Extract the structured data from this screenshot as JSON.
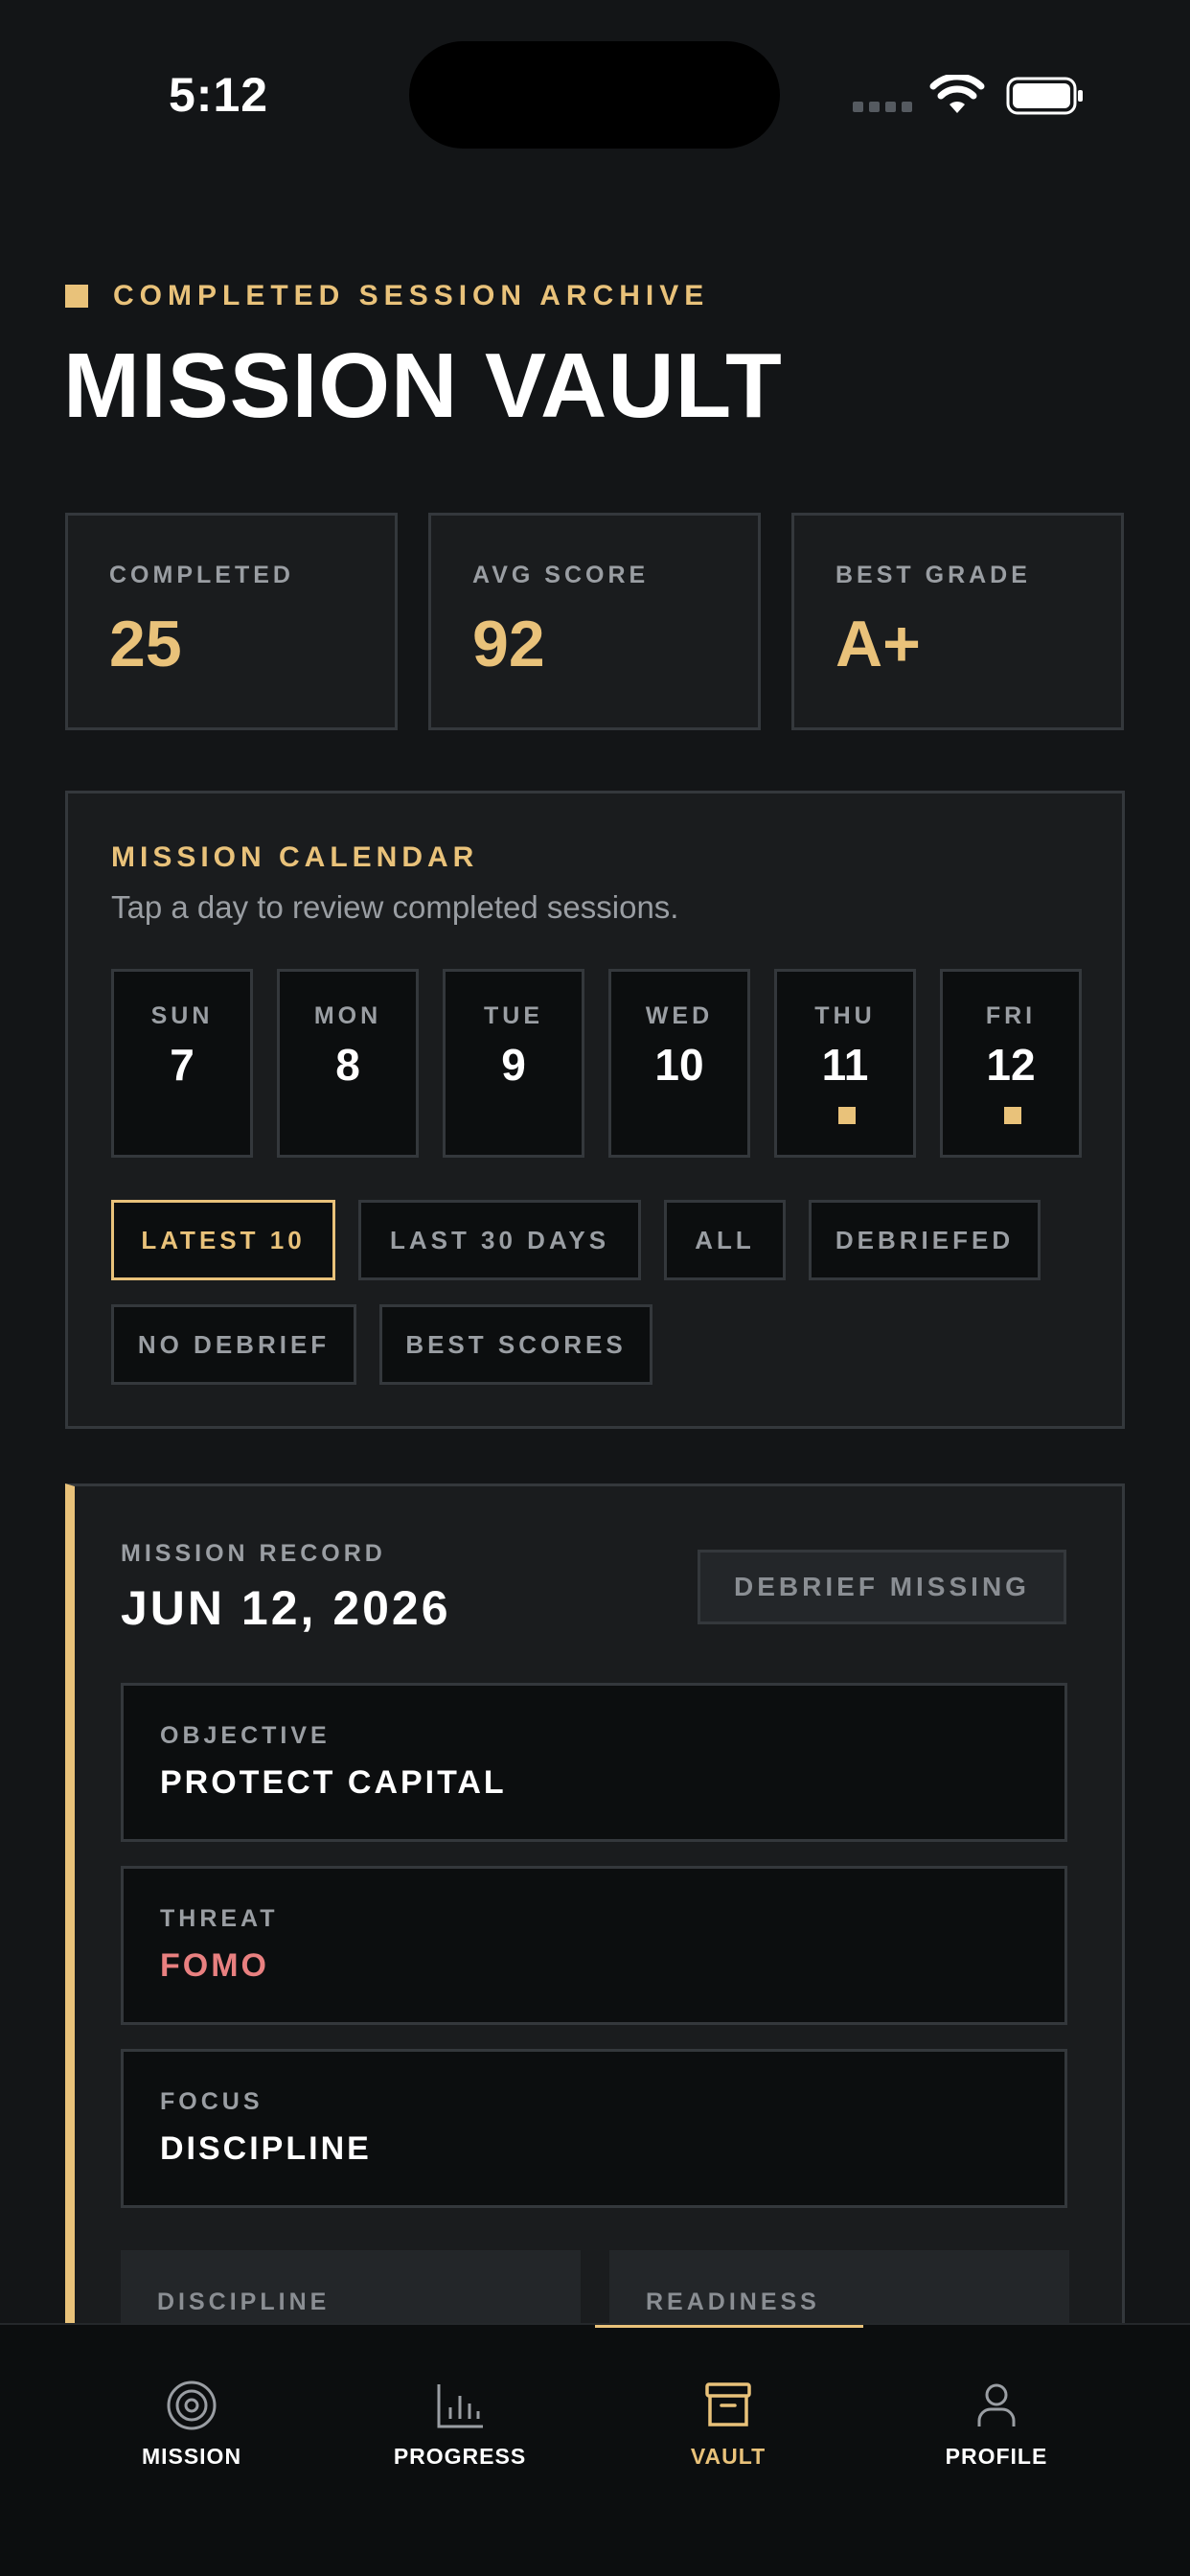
{
  "status_bar": {
    "time": "5:12"
  },
  "header": {
    "eyebrow": "COMPLETED SESSION ARCHIVE",
    "title": "MISSION VAULT"
  },
  "stats": [
    {
      "label": "COMPLETED",
      "value": "25"
    },
    {
      "label": "AVG SCORE",
      "value": "92"
    },
    {
      "label": "BEST GRADE",
      "value": "A+"
    }
  ],
  "calendar": {
    "title": "MISSION CALENDAR",
    "subtitle": "Tap a day to review completed sessions.",
    "days": [
      {
        "name": "SUN",
        "num": "7",
        "has_session": false
      },
      {
        "name": "MON",
        "num": "8",
        "has_session": false
      },
      {
        "name": "TUE",
        "num": "9",
        "has_session": false
      },
      {
        "name": "WED",
        "num": "10",
        "has_session": false
      },
      {
        "name": "THU",
        "num": "11",
        "has_session": true
      },
      {
        "name": "FRI",
        "num": "12",
        "has_session": true
      }
    ],
    "filters": [
      {
        "label": "LATEST 10",
        "active": true
      },
      {
        "label": "LAST 30 DAYS",
        "active": false
      },
      {
        "label": "ALL",
        "active": false
      },
      {
        "label": "DEBRIEFED",
        "active": false
      },
      {
        "label": "NO DEBRIEF",
        "active": false
      },
      {
        "label": "BEST SCORES",
        "active": false
      }
    ]
  },
  "record": {
    "label": "MISSION RECORD",
    "date": "JUN 12, 2026",
    "badge": "DEBRIEF MISSING",
    "fields": [
      {
        "label": "OBJECTIVE",
        "value": "PROTECT CAPITAL"
      },
      {
        "label": "THREAT",
        "value": "FOMO"
      },
      {
        "label": "FOCUS",
        "value": "DISCIPLINE"
      }
    ],
    "metrics": [
      {
        "label": "DISCIPLINE"
      },
      {
        "label": "READINESS"
      }
    ]
  },
  "tabs": [
    {
      "label": "MISSION",
      "icon": "target-icon",
      "active": false
    },
    {
      "label": "PROGRESS",
      "icon": "bar-chart-icon",
      "active": false
    },
    {
      "label": "VAULT",
      "icon": "archive-box-icon",
      "active": true
    },
    {
      "label": "PROFILE",
      "icon": "person-icon",
      "active": false
    }
  ],
  "colors": {
    "accent": "#e9c27a",
    "threat": "#e98080",
    "background": "#131517",
    "panel": "#1a1c1e"
  }
}
